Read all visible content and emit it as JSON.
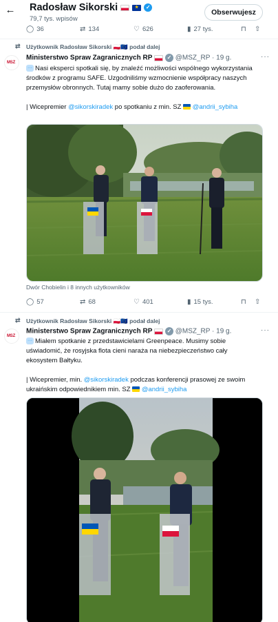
{
  "header": {
    "back_glyph": "←",
    "name": "Radosław Sikorski",
    "post_count": "79,7 tys. wpisów",
    "follow_label": "Obserwujesz"
  },
  "top_actions": {
    "replies": "36",
    "reposts": "134",
    "likes": "626",
    "views": "27 tys."
  },
  "tweets": [
    {
      "repost_label": "Użytkownik Radosław Sikorski 🇵🇱🇪🇺 podał dalej",
      "author_name": "Ministerstwo Spraw Zagranicznych RP",
      "handle_time": "@MSZ_RP · 19 g.",
      "avatar_text": "MSZ",
      "text_line1": "Nasi eksperci spotkali się, by znaleźć możliwości wspólnego wykorzystania środków z programu SAFE. Uzgodniliśmy wzmocnienie współpracy naszych przemysłów obronnych. Tutaj mamy sobie dużo do zaoferowania.",
      "text_line2_prefix": "| Wicepremier",
      "mention1": "@sikorskiradek",
      "text_line2_mid": "po spotkaniu z min. SZ",
      "mention2": "@andrii_sybiha",
      "media_caption": "Dwór Chobielin i 8 innych użytkowników",
      "actions": {
        "replies": "57",
        "reposts": "68",
        "likes": "401",
        "views": "15 tys."
      }
    },
    {
      "repost_label": "Użytkownik Radosław Sikorski 🇵🇱🇪🇺 podał dalej",
      "author_name": "Ministerstwo Spraw Zagranicznych RP",
      "handle_time": "@MSZ_RP · 19 g.",
      "avatar_text": "MSZ",
      "text_line1": "Miałem spotkanie z przedstawicielami Greenpeace. Musimy sobie uświadomić, że rosyjska flota cieni naraża na niebezpieczeństwo cały ekosystem Bałtyku.",
      "text_line2_prefix": "| Wicepremier, min.",
      "mention1": "@sikorskiradek",
      "text_line2_mid": "podczas konferencji prasowej ze swoim ukraińskim odpowiednikiem min. SZ",
      "mention2": "@andrii_sybiha"
    }
  ],
  "icons": {
    "reply": "💬",
    "repost": "⟲",
    "like": "♡",
    "views": "📊",
    "bookmark": "🔖",
    "share": "⇧",
    "more": "···"
  }
}
